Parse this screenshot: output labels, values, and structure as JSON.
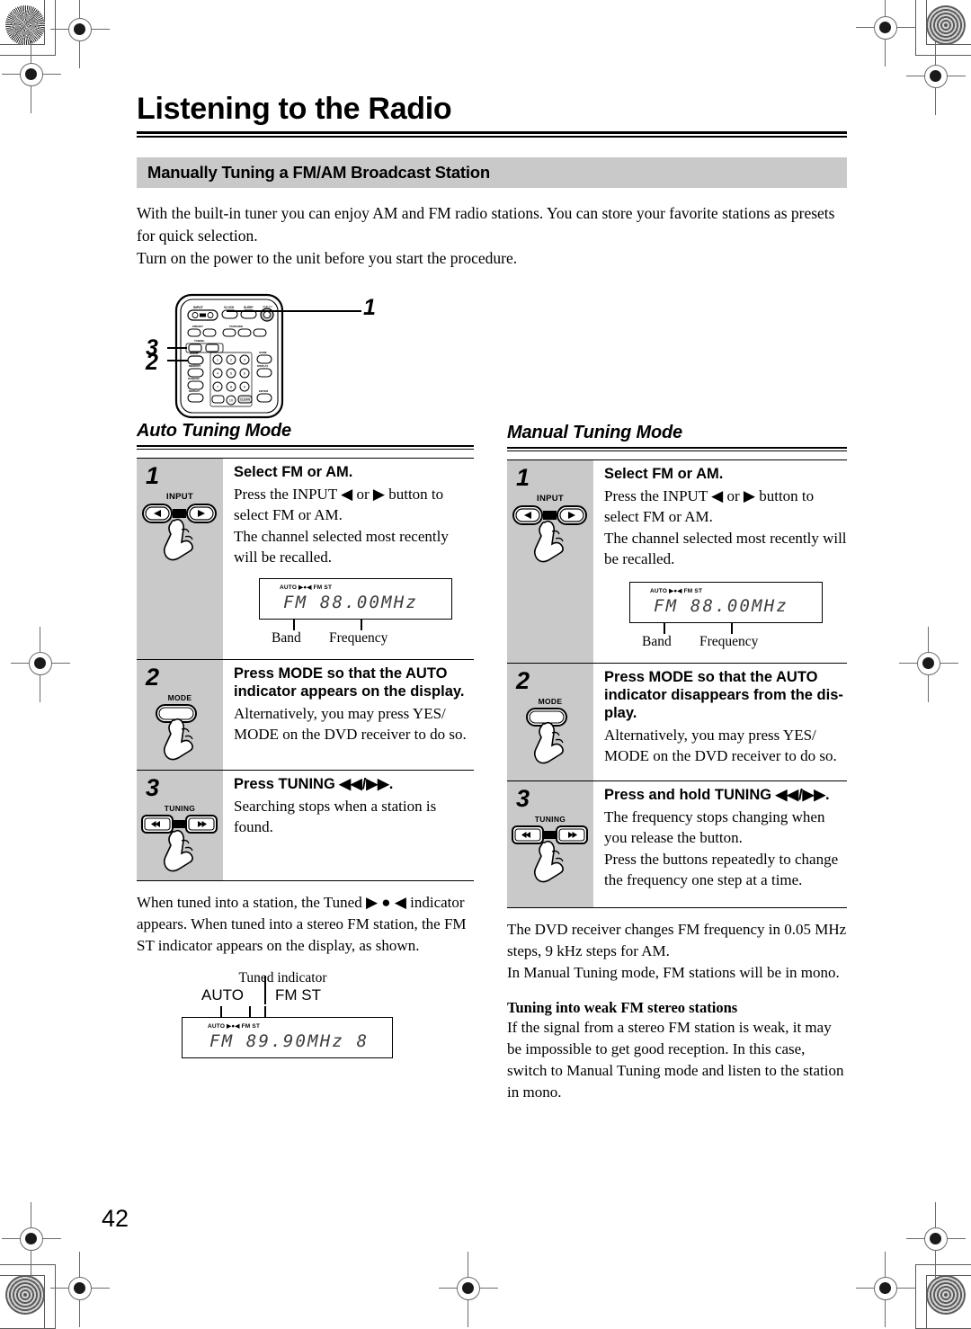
{
  "page": {
    "title": "Listening to the Radio",
    "folio": "42",
    "section_band": "Manually Tuning a FM/AM Broadcast Station",
    "intro": [
      "With the built-in tuner you can enjoy AM and FM radio stations. You can store your favorite stations as presets for quick selection.",
      "Turn on the power to the unit before you start the procedure."
    ]
  },
  "remote_figure": {
    "callout_1": "1",
    "callout_2": "2",
    "callout_3": "3"
  },
  "auto_mode": {
    "heading": "Auto Tuning Mode",
    "steps": [
      {
        "num": "1",
        "button_label": "INPUT",
        "title": "Select FM or AM.",
        "lines": [
          "Press the INPUT ◀ or ▶ button to select FM or AM.",
          "The channel selected most recently will be recalled."
        ],
        "display": {
          "indicators": "AUTO ▶●◀ FM ST",
          "readout": "FM  88.00MHz",
          "label_left": "Band",
          "label_right": "Frequency"
        }
      },
      {
        "num": "2",
        "button_label": "MODE",
        "title": "Press MODE so that the AUTO indicator appears on the display.",
        "lines": [
          "Alternatively, you may press YES/ MODE on the DVD receiver to do so."
        ]
      },
      {
        "num": "3",
        "button_label": "TUNING",
        "title": "Press TUNING ◀◀/▶▶.",
        "lines": [
          "Searching stops when a station is found."
        ]
      }
    ],
    "tail": [
      "When tuned into a station, the Tuned ▶ ● ◀ indicator appears. When tuned into a stereo FM station, the FM ST indicator appears on the display, as shown."
    ],
    "tuned_display": {
      "caption_top": "Tuned indicator",
      "caption_left": "AUTO",
      "caption_right": "FM ST",
      "indicators": "AUTO ▶●◀ FM ST",
      "readout": "FM  89.90MHz   8"
    }
  },
  "manual_mode": {
    "heading": "Manual Tuning Mode",
    "steps": [
      {
        "num": "1",
        "button_label": "INPUT",
        "title": "Select FM or AM.",
        "lines": [
          "Press the INPUT ◀ or ▶ button to select FM or AM.",
          "The channel selected most recently will be recalled."
        ],
        "display": {
          "indicators": "AUTO ▶●◀ FM ST",
          "readout": "FM  88.00MHz",
          "label_left": "Band",
          "label_right": "Frequency"
        }
      },
      {
        "num": "2",
        "button_label": "MODE",
        "title": "Press MODE so that the AUTO indicator disappears from the dis-play.",
        "lines": [
          "Alternatively, you may press YES/ MODE on the DVD receiver to do so."
        ]
      },
      {
        "num": "3",
        "button_label": "TUNING",
        "title": "Press and hold TUNING ◀◀/▶▶.",
        "lines": [
          "The frequency stops changing when you release the button.",
          "Press the buttons repeatedly to change the frequency one step at a time."
        ]
      }
    ],
    "tail": [
      "The DVD receiver changes FM frequency in 0.05 MHz steps, 9 kHz steps for AM.",
      "In Manual Tuning mode, FM stations will be in mono."
    ],
    "subsection": {
      "heading": "Tuning into weak FM stereo stations",
      "body": "If the signal from a stereo FM station is weak, it may be impossible to get good reception. In this case, switch to Manual Tuning mode and listen to the station in mono."
    }
  },
  "colors": {
    "band_gray": "#c9c9c9",
    "text": "#000000",
    "lcd_text": "#3d3d3d"
  }
}
